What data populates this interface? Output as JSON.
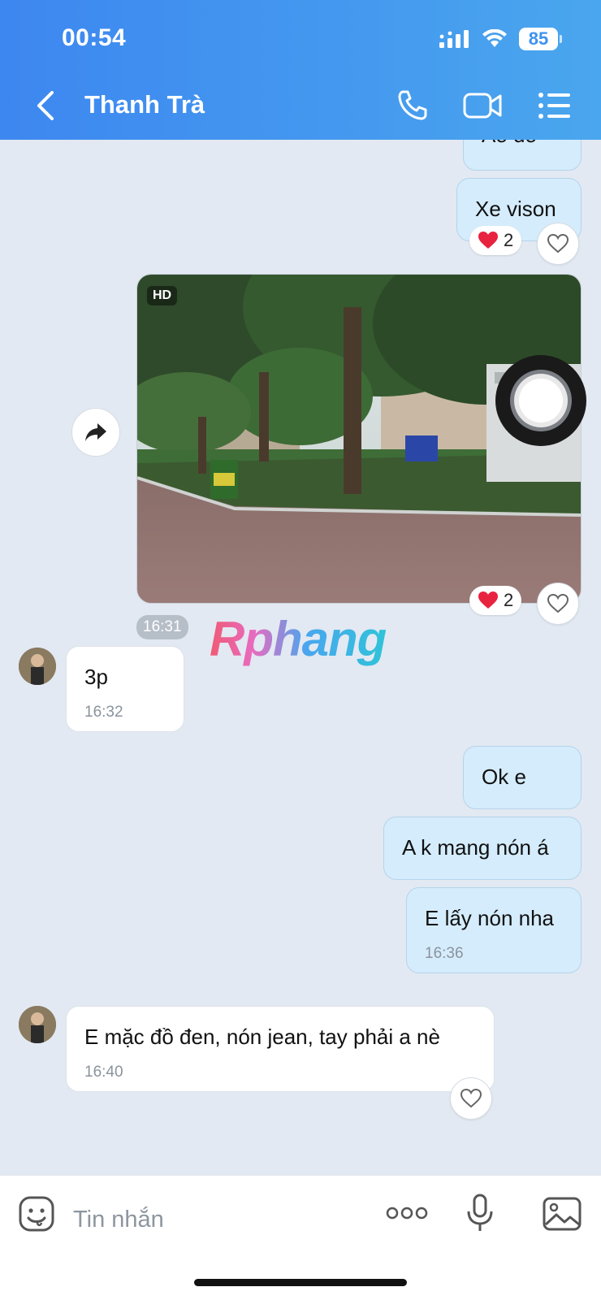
{
  "status_bar": {
    "time": "00:54",
    "battery": "85"
  },
  "header": {
    "title": "Thanh Trà"
  },
  "messages": {
    "partial_top": "Áo đỏ",
    "xe_vison": "Xe vison",
    "reaction_count_1": "2",
    "photo_badge": "HD",
    "reaction_count_2": "2",
    "photo_time": "16:31",
    "in_1_text": "3p",
    "in_1_time": "16:32",
    "out_ok": "Ok e",
    "out_mang": "A k mang nón á",
    "out_lay": "E lấy nón nha",
    "out_lay_time": "16:36",
    "in_2_text": "E mặc đồ đen, nón jean, tay phải a nè",
    "in_2_time": "16:40"
  },
  "watermark": "Rphang",
  "composer": {
    "placeholder": "Tin nhắn"
  },
  "colors": {
    "header_start": "#3d87f0",
    "header_end": "#4aa6ee",
    "chat_bg": "#e2e9f2",
    "outgoing_bubble": "#d5ecfc",
    "incoming_bubble": "#ffffff"
  },
  "icons": [
    "signal-icon",
    "wifi-icon",
    "battery-icon",
    "back-icon",
    "phone-icon",
    "video-call-icon",
    "menu-icon",
    "heart-reaction-icon",
    "heart-outline-icon",
    "share-icon",
    "record-icon",
    "sticker-icon",
    "more-icon",
    "mic-icon",
    "gallery-icon"
  ]
}
